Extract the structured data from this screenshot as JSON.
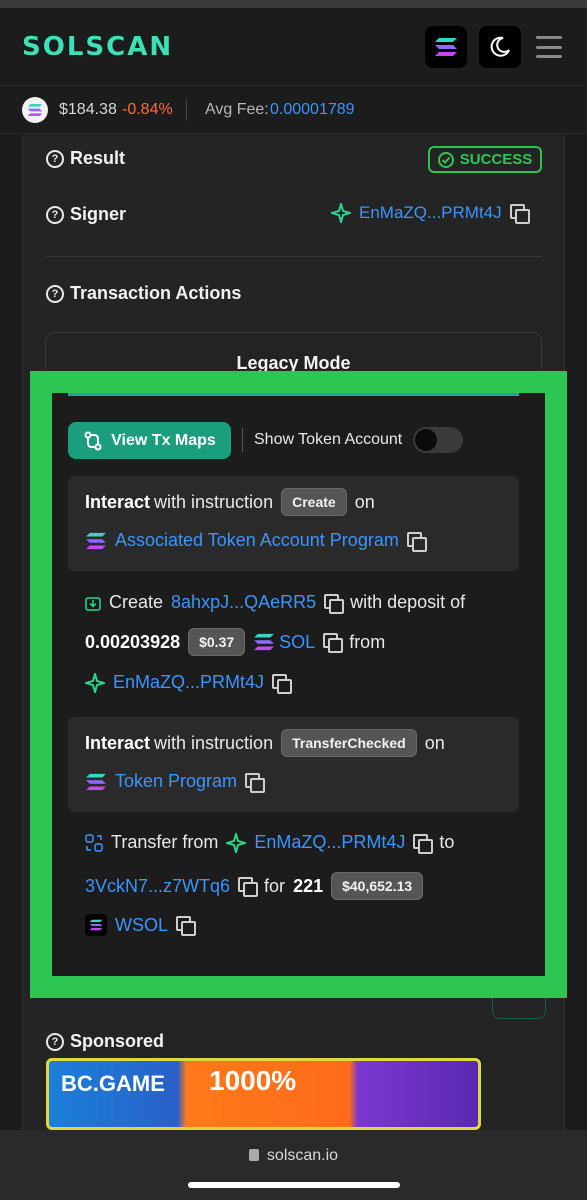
{
  "header": {
    "logo": "SOLSCAN",
    "solana_button_icon": "solana-logo-icon",
    "theme_button_icon": "moon-icon",
    "menu_icon": "hamburger-menu-icon"
  },
  "pricebar": {
    "price": "$184.38",
    "change": "-0.84%",
    "avg_fee_label": "Avg Fee:",
    "avg_fee_value": "0.00001789"
  },
  "result": {
    "label": "Result",
    "status": "SUCCESS"
  },
  "signer": {
    "label": "Signer",
    "address": "EnMaZQ...PRMt4J"
  },
  "actions": {
    "label": "Transaction Actions",
    "mode_title": "Legacy Mode",
    "view_tx_maps": "View Tx Maps",
    "show_token_account": "Show Token Account"
  },
  "instructions": [
    {
      "interact": "Interact",
      "with_instruction": "with instruction",
      "name": "Create",
      "on": "on",
      "program": "Associated Token Account Program"
    },
    {
      "interact": "Interact",
      "with_instruction": "with instruction",
      "name": "TransferChecked",
      "on": "on",
      "program": "Token Program"
    }
  ],
  "create_detail": {
    "verb": "Create",
    "account": "8ahxpJ...QAeRR5",
    "with_deposit_of": "with deposit of",
    "amount": "0.00203928",
    "usd": "$0.37",
    "token": "SOL",
    "from": "from",
    "from_address": "EnMaZQ...PRMt4J"
  },
  "transfer_detail": {
    "verb": "Transfer from",
    "from_address": "EnMaZQ...PRMt4J",
    "to": "to",
    "to_address": "3VckN7...z7WTq6",
    "for": "for",
    "amount": "221",
    "usd": "$40,652.13",
    "token": "WSOL"
  },
  "sponsored": {
    "label": "Sponsored",
    "ad_brand": "BC.GAME",
    "ad_text": "1000%"
  },
  "browser": {
    "url": "solscan.io"
  },
  "colors": {
    "accent": "#3ee0b8",
    "link": "#3b95ff",
    "success": "#2dc653",
    "negative": "#ff6a3d",
    "highlight_border": "#2dc653"
  }
}
